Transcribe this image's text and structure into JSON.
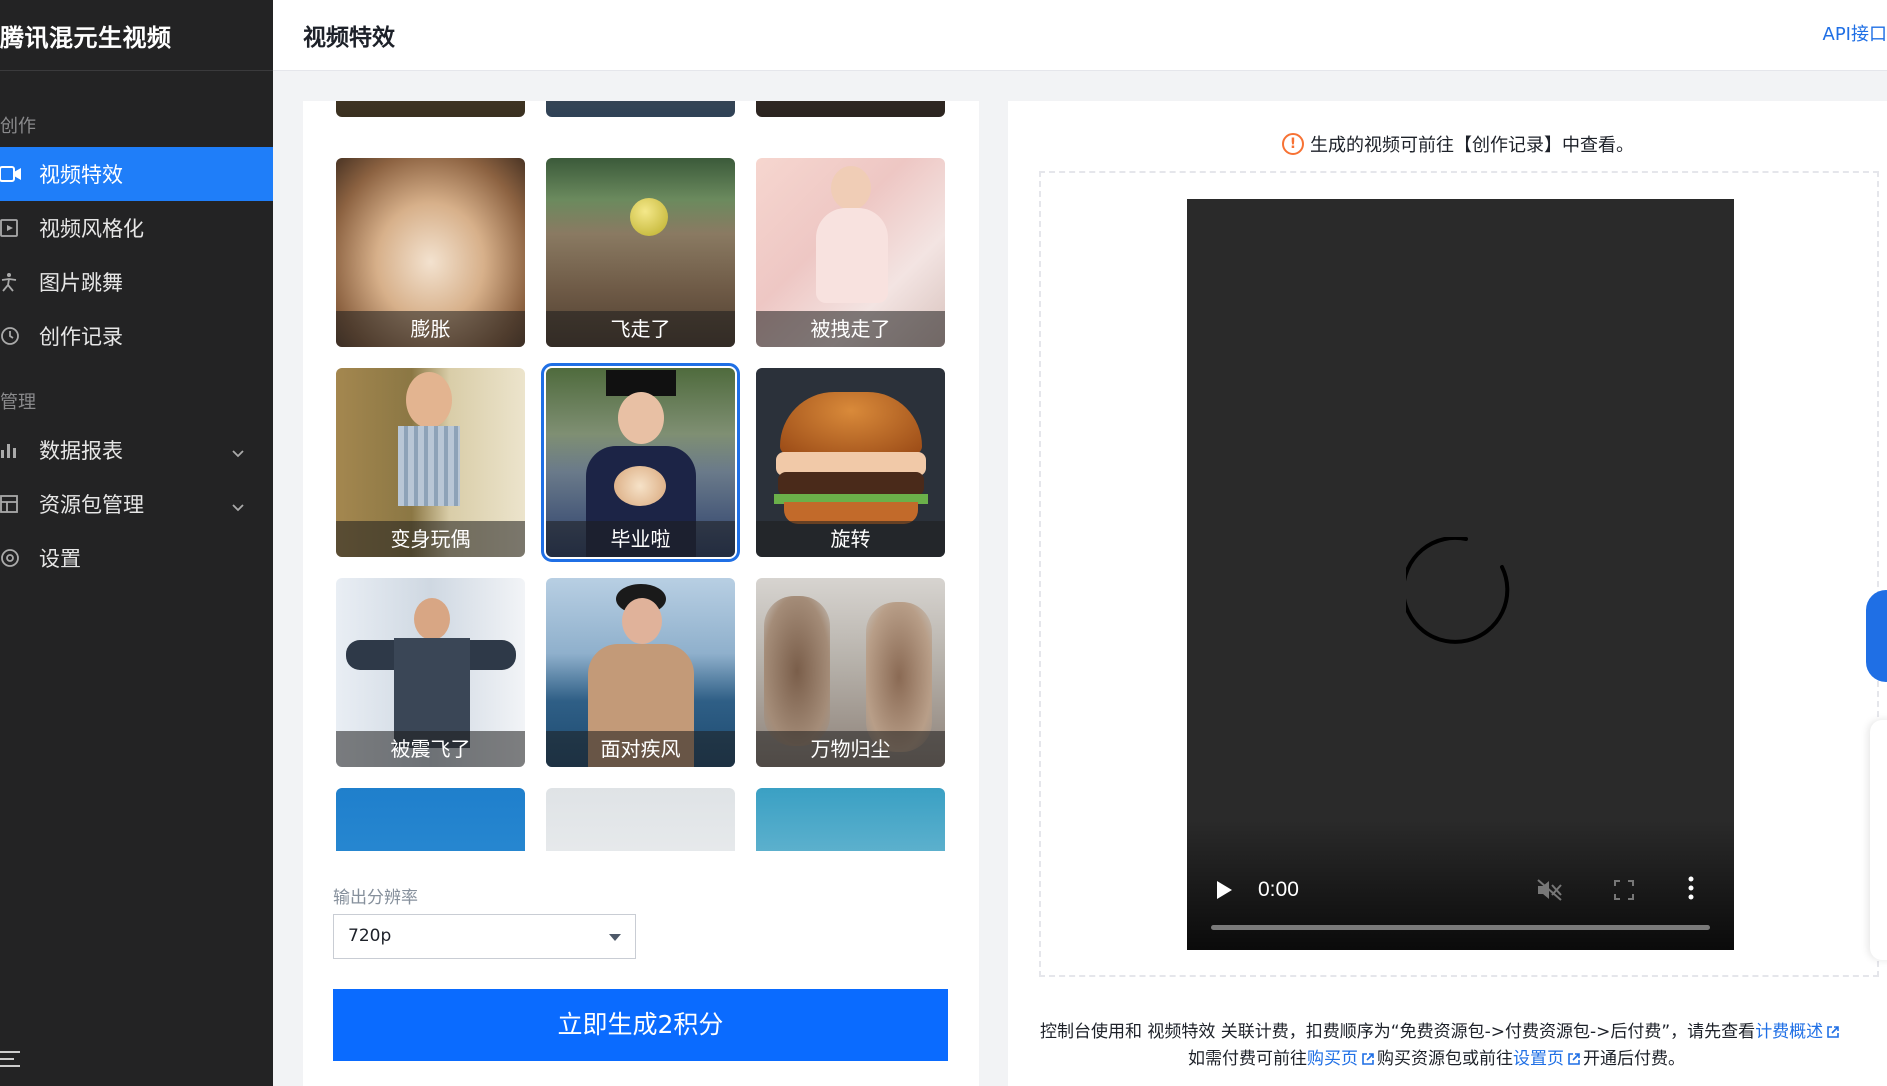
{
  "app": {
    "brand": "腾讯混元生视频"
  },
  "sidebar": {
    "group_create": "创作",
    "group_manage": "管理",
    "items": [
      {
        "label": "视频特效",
        "icon": "video-camera-icon",
        "active": true
      },
      {
        "label": "视频风格化",
        "icon": "video-play-icon"
      },
      {
        "label": "图片跳舞",
        "icon": "dancing-person-icon"
      },
      {
        "label": "创作记录",
        "icon": "history-clock-icon"
      },
      {
        "label": "数据报表",
        "icon": "bar-chart-icon",
        "expandable": true
      },
      {
        "label": "资源包管理",
        "icon": "package-icon",
        "expandable": true
      },
      {
        "label": "设置",
        "icon": "settings-gear-icon"
      }
    ]
  },
  "header": {
    "title": "视频特效",
    "api_link": "API接口"
  },
  "effects": {
    "tiles": [
      {
        "caption": "膨胀"
      },
      {
        "caption": "飞走了"
      },
      {
        "caption": "被拽走了"
      },
      {
        "caption": "变身玩偶"
      },
      {
        "caption": "毕业啦",
        "selected": true
      },
      {
        "caption": "旋转"
      },
      {
        "caption": "被震飞了"
      },
      {
        "caption": "面对疾风"
      },
      {
        "caption": "万物归尘"
      }
    ]
  },
  "resolution": {
    "label": "输出分辨率",
    "value": "720p"
  },
  "generate": {
    "label": "立即生成2积分"
  },
  "preview": {
    "notice": "生成的视频可前往【创作记录】中查看。",
    "time": "0:00",
    "progress": 0
  },
  "footer": {
    "line1_text": "控制台使用和 视频特效 关联计费，扣费顺序为“免费资源包->付费资源包->后付费”，请先查看",
    "line1_link": "计费概述",
    "line2_pre": "如需付费可前往",
    "line2_link1": "购买页",
    "line2_mid": "购买资源包或前往",
    "line2_link2": "设置页",
    "line2_post": "开通后付费。"
  },
  "colors": {
    "accent": "#0a6bff",
    "sidebar_bg": "#232324",
    "active_item": "#1f7ef9",
    "link": "#1f6fe5",
    "warn": "#f77234"
  }
}
